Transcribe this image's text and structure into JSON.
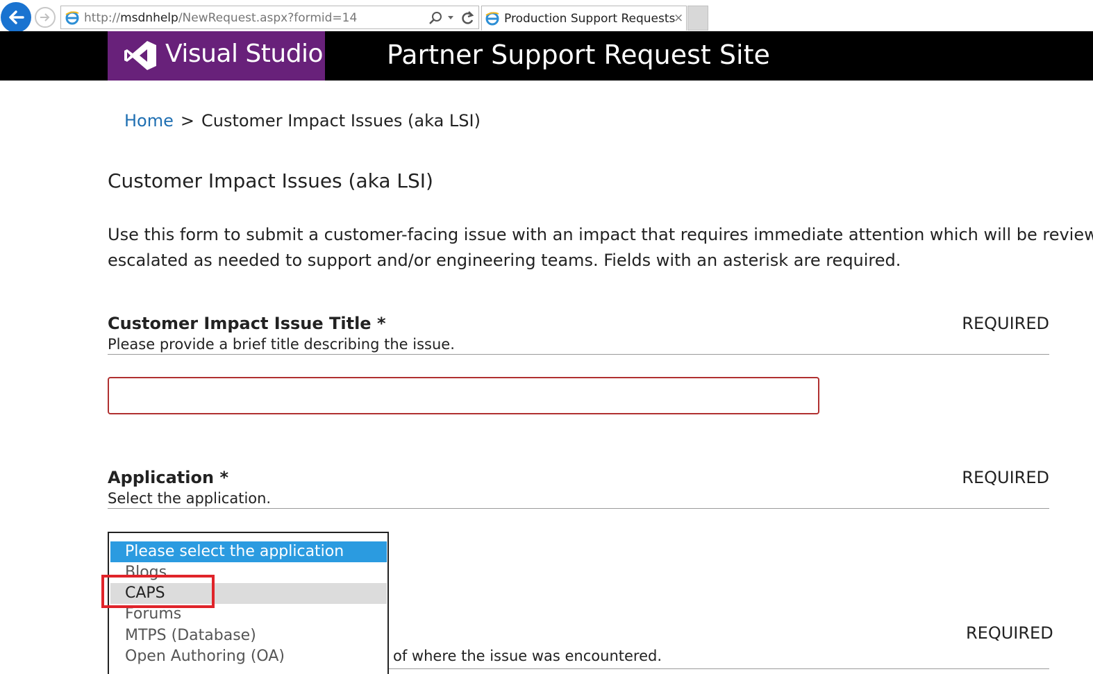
{
  "browser": {
    "url_prefix": "http://",
    "url_host": "msdnhelp",
    "url_path": "/NewRequest.aspx?formid=14",
    "tab_title": "Production Support Requests",
    "tab_close": "×"
  },
  "header": {
    "logo_text": "Visual Studio",
    "site_title": "Partner Support Request Site"
  },
  "breadcrumb": {
    "home": "Home",
    "separator": ">",
    "current": "Customer Impact Issues (aka LSI)"
  },
  "page": {
    "title": "Customer Impact Issues (aka LSI)",
    "intro_line1": "Use this form to submit a customer-facing issue with an impact that requires immediate attention which will be reviewed by",
    "intro_line2": "escalated as needed to support and/or engineering teams. Fields with an asterisk are required."
  },
  "fields": {
    "title_field": {
      "label": "Customer Impact Issue Title *",
      "description": "Please provide a brief title describing the issue.",
      "required": "REQUIRED",
      "value": ""
    },
    "application_field": {
      "label": "Application *",
      "description": "Select the application.",
      "required": "REQUIRED",
      "options": [
        "Please select the application",
        "Blogs",
        "CAPS",
        "Forums",
        "MTPS (Database)",
        "Open Authoring (OA)"
      ],
      "selected": "Please select the application",
      "hovered": "CAPS"
    },
    "location_field": {
      "description_partial": "of where the issue was encountered.",
      "required": "REQUIRED"
    }
  },
  "colors": {
    "header_bg": "#000000",
    "logo_bg": "#68217a",
    "link": "#1f6fb2",
    "selected_option": "#2b9be0",
    "highlight_box": "#e0242a"
  }
}
